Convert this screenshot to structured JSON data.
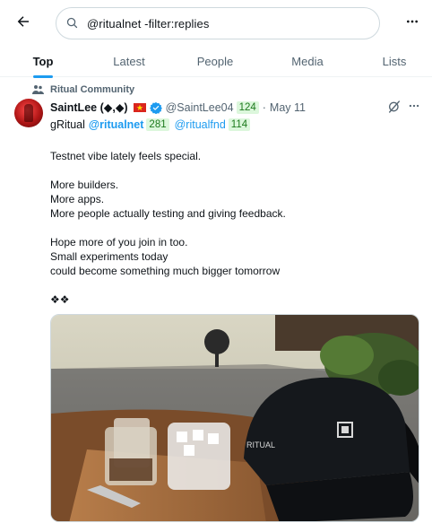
{
  "search": {
    "query": "@ritualnet -filter:replies"
  },
  "tabs": [
    {
      "label": "Top",
      "active": true
    },
    {
      "label": "Latest",
      "active": false
    },
    {
      "label": "People",
      "active": false
    },
    {
      "label": "Media",
      "active": false
    },
    {
      "label": "Lists",
      "active": false
    }
  ],
  "post": {
    "community": "Ritual Community",
    "author_name": "SaintLee (◆,◆)",
    "author_handle": "@SaintLee04",
    "handle_badge": "124",
    "date": "May 11",
    "line2_prefix": "gRitual",
    "mention1": "@ritualnet",
    "mention1_badge": "281",
    "mention2": "@ritualfnd",
    "mention2_badge": "114",
    "paragraphs": [
      [
        "Testnet vibe lately feels special."
      ],
      [
        "More builders.",
        "More apps.",
        "More people actually testing and giving feedback."
      ],
      [
        "Hope more of you join in too.",
        "Small experiments today",
        "could become something much bigger tomorrow"
      ],
      [
        "❖❖"
      ]
    ],
    "image_text": {
      "cap_print": "RITUAL"
    }
  },
  "colors": {
    "accent": "#1d9bf0",
    "badge_bg": "#dcf7dc",
    "muted": "#536471"
  },
  "icons": [
    "back-arrow-icon",
    "search-icon",
    "more-icon",
    "community-icon",
    "verified-icon",
    "flag-icon",
    "grok-icon"
  ]
}
